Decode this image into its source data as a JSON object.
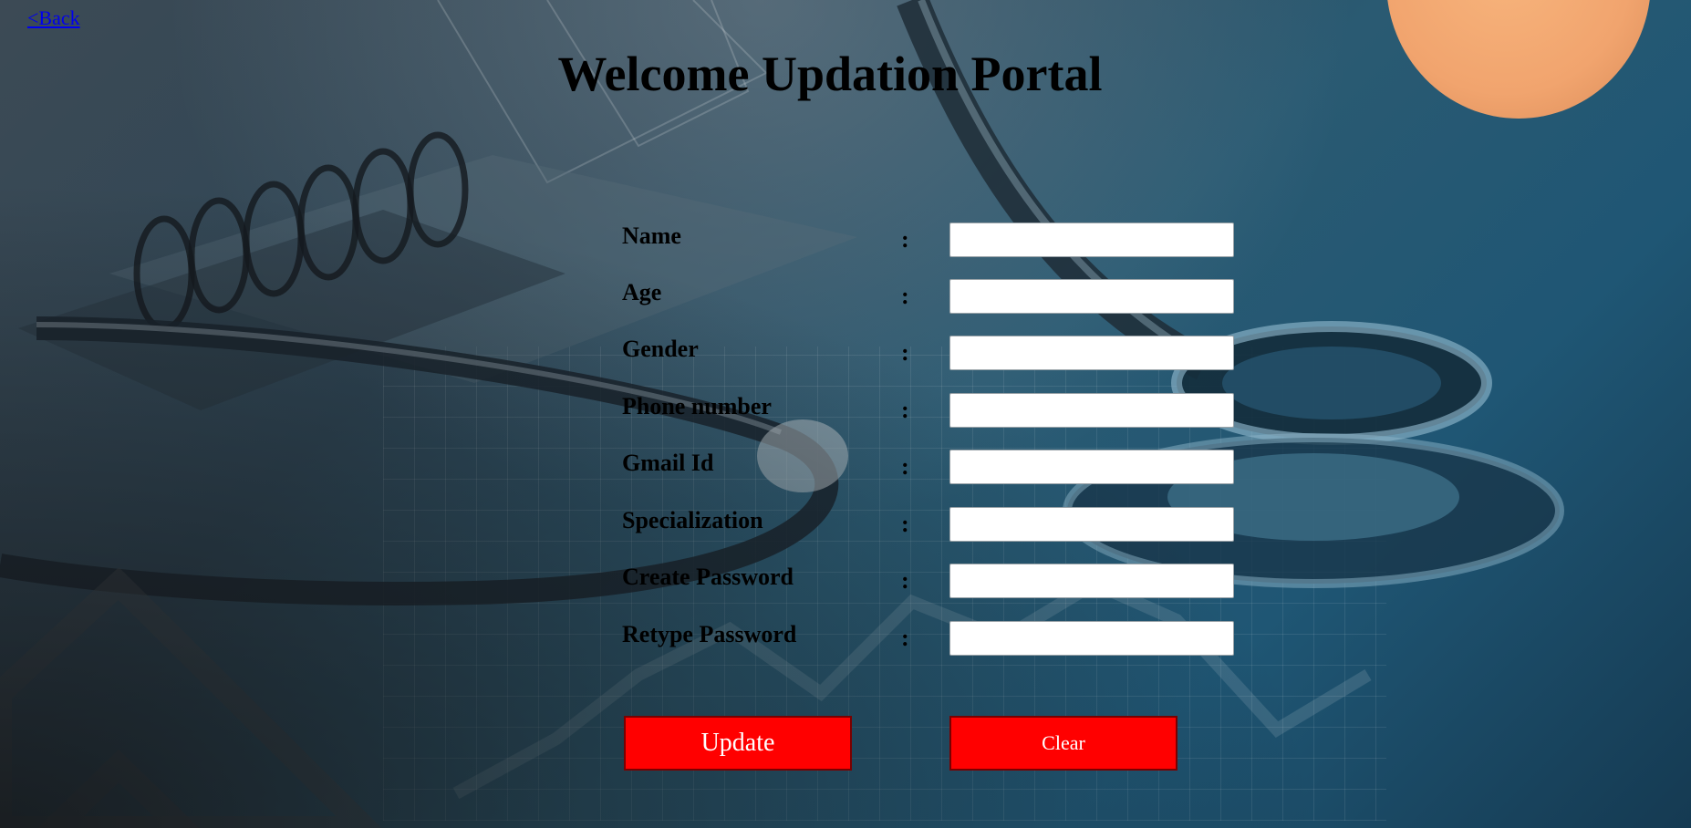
{
  "nav": {
    "back_label": "<Back"
  },
  "page": {
    "title": "Welcome Updation Portal"
  },
  "form": {
    "separator": ":",
    "fields": [
      {
        "label": "Name",
        "value": ""
      },
      {
        "label": "Age",
        "value": ""
      },
      {
        "label": "Gender",
        "value": ""
      },
      {
        "label": "Phone number",
        "value": ""
      },
      {
        "label": "Gmail Id",
        "value": ""
      },
      {
        "label": "Specialization",
        "value": ""
      },
      {
        "label": "Create Password",
        "value": ""
      },
      {
        "label": "Retype Password",
        "value": ""
      }
    ]
  },
  "actions": {
    "update_label": "Update",
    "clear_label": "Clear"
  },
  "colors": {
    "button_bg": "#ff0000",
    "button_text": "#ffffff",
    "link": "#0000ee"
  },
  "icons": [
    "stethoscope-image",
    "notebook-image"
  ]
}
